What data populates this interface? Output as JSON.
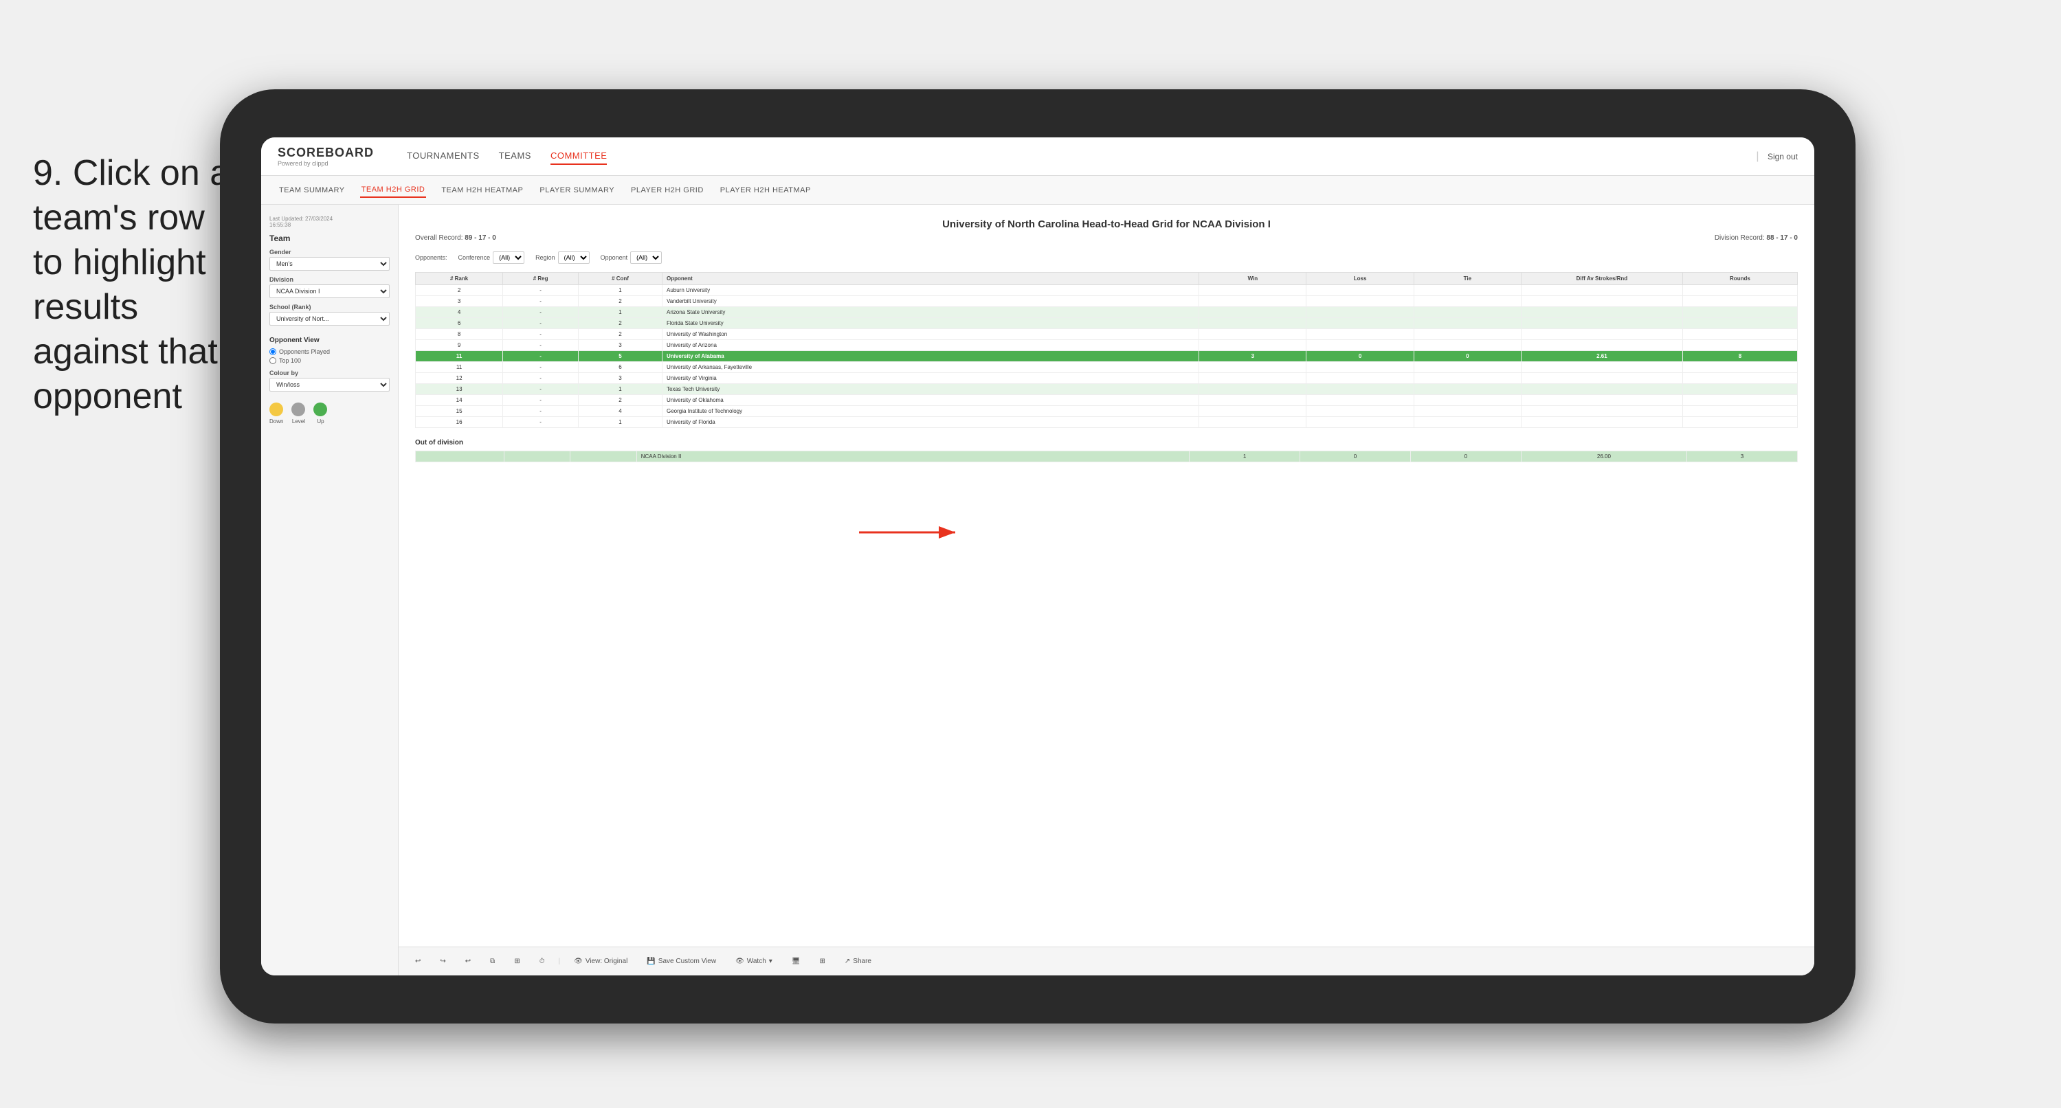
{
  "instruction": {
    "step": "9.",
    "text": "Click on a team's row to highlight results against that opponent"
  },
  "nav": {
    "logo": "SCOREBOARD",
    "logo_sub": "Powered by clippd",
    "items": [
      "TOURNAMENTS",
      "TEAMS",
      "COMMITTEE"
    ],
    "sign_out": "Sign out"
  },
  "sub_nav": {
    "items": [
      "TEAM SUMMARY",
      "TEAM H2H GRID",
      "TEAM H2H HEATMAP",
      "PLAYER SUMMARY",
      "PLAYER H2H GRID",
      "PLAYER H2H HEATMAP"
    ],
    "active": "TEAM H2H GRID"
  },
  "sidebar": {
    "last_updated_label": "Last Updated: 27/03/2024",
    "time": "16:55:38",
    "team_label": "Team",
    "gender_label": "Gender",
    "gender_value": "Men's",
    "division_label": "Division",
    "division_value": "NCAA Division I",
    "school_label": "School (Rank)",
    "school_value": "University of Nort...",
    "opponent_view_label": "Opponent View",
    "radio_opponents": "Opponents Played",
    "radio_top100": "Top 100",
    "colour_by_label": "Colour by",
    "colour_by_value": "Win/loss",
    "legend_down": "Down",
    "legend_level": "Level",
    "legend_up": "Up"
  },
  "main": {
    "title": "University of North Carolina Head-to-Head Grid for NCAA Division I",
    "overall_record_label": "Overall Record:",
    "overall_record": "89 - 17 - 0",
    "division_record_label": "Division Record:",
    "division_record": "88 - 17 - 0",
    "opponents_label": "Opponents:",
    "conference_label": "Conference",
    "conference_value": "(All)",
    "region_label": "Region",
    "region_value": "(All)",
    "opponent_label": "Opponent",
    "opponent_value": "(All)",
    "table_headers": {
      "rank": "# Rank",
      "reg": "# Reg",
      "conf": "# Conf",
      "opponent": "Opponent",
      "win": "Win",
      "loss": "Loss",
      "tie": "Tie",
      "diff_av": "Diff Av Strokes/Rnd",
      "rounds": "Rounds"
    },
    "rows": [
      {
        "rank": "2",
        "reg": "-",
        "conf": "1",
        "opponent": "Auburn University",
        "win": "",
        "loss": "",
        "tie": "",
        "diff": "",
        "rounds": "",
        "highlight": false,
        "green_light": false
      },
      {
        "rank": "3",
        "reg": "-",
        "conf": "2",
        "opponent": "Vanderbilt University",
        "win": "",
        "loss": "",
        "tie": "",
        "diff": "",
        "rounds": "",
        "highlight": false,
        "green_light": false
      },
      {
        "rank": "4",
        "reg": "-",
        "conf": "1",
        "opponent": "Arizona State University",
        "win": "",
        "loss": "",
        "tie": "",
        "diff": "",
        "rounds": "",
        "highlight": false,
        "green_light": true
      },
      {
        "rank": "6",
        "reg": "-",
        "conf": "2",
        "opponent": "Florida State University",
        "win": "",
        "loss": "",
        "tie": "",
        "diff": "",
        "rounds": "",
        "highlight": false,
        "green_light": true
      },
      {
        "rank": "8",
        "reg": "-",
        "conf": "2",
        "opponent": "University of Washington",
        "win": "",
        "loss": "",
        "tie": "",
        "diff": "",
        "rounds": "",
        "highlight": false,
        "green_light": false
      },
      {
        "rank": "9",
        "reg": "-",
        "conf": "3",
        "opponent": "University of Arizona",
        "win": "",
        "loss": "",
        "tie": "",
        "diff": "",
        "rounds": "",
        "highlight": false,
        "green_light": false
      },
      {
        "rank": "11",
        "reg": "-",
        "conf": "5",
        "opponent": "University of Alabama",
        "win": "3",
        "loss": "0",
        "tie": "0",
        "diff": "2.61",
        "rounds": "8",
        "highlight": true,
        "green_light": false
      },
      {
        "rank": "11",
        "reg": "-",
        "conf": "6",
        "opponent": "University of Arkansas, Fayetteville",
        "win": "",
        "loss": "",
        "tie": "",
        "diff": "",
        "rounds": "",
        "highlight": false,
        "green_light": false
      },
      {
        "rank": "12",
        "reg": "-",
        "conf": "3",
        "opponent": "University of Virginia",
        "win": "",
        "loss": "",
        "tie": "",
        "diff": "",
        "rounds": "",
        "highlight": false,
        "green_light": false
      },
      {
        "rank": "13",
        "reg": "-",
        "conf": "1",
        "opponent": "Texas Tech University",
        "win": "",
        "loss": "",
        "tie": "",
        "diff": "",
        "rounds": "",
        "highlight": false,
        "green_light": true
      },
      {
        "rank": "14",
        "reg": "-",
        "conf": "2",
        "opponent": "University of Oklahoma",
        "win": "",
        "loss": "",
        "tie": "",
        "diff": "",
        "rounds": "",
        "highlight": false,
        "green_light": false
      },
      {
        "rank": "15",
        "reg": "-",
        "conf": "4",
        "opponent": "Georgia Institute of Technology",
        "win": "",
        "loss": "",
        "tie": "",
        "diff": "",
        "rounds": "",
        "highlight": false,
        "green_light": false
      },
      {
        "rank": "16",
        "reg": "-",
        "conf": "1",
        "opponent": "University of Florida",
        "win": "",
        "loss": "",
        "tie": "",
        "diff": "",
        "rounds": "",
        "highlight": false,
        "green_light": false
      }
    ],
    "out_of_division_label": "Out of division",
    "out_of_division_row": {
      "division": "NCAA Division II",
      "win": "1",
      "loss": "0",
      "tie": "0",
      "diff": "26.00",
      "rounds": "3"
    }
  },
  "toolbar": {
    "view_label": "View: Original",
    "save_custom_label": "Save Custom View",
    "watch_label": "Watch",
    "share_label": "Share"
  },
  "colors": {
    "accent": "#e8321e",
    "highlight_green": "#4caf50",
    "cell_green_light": "#c8e6c9",
    "cell_green_medium": "#a5d6a7",
    "legend_down": "#f4c842",
    "legend_level": "#a0a0a0",
    "legend_up": "#4caf50"
  }
}
